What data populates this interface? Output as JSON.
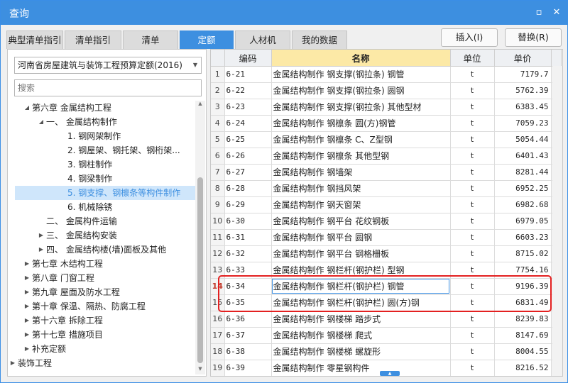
{
  "window": {
    "title": "查询",
    "minimize_glyph": "▫",
    "close_glyph": "✕"
  },
  "tabs": [
    {
      "label": "典型清单指引",
      "active": false
    },
    {
      "label": "清单指引",
      "active": false
    },
    {
      "label": "清单",
      "active": false
    },
    {
      "label": "定额",
      "active": true
    },
    {
      "label": "人材机",
      "active": false
    },
    {
      "label": "我的数据",
      "active": false
    }
  ],
  "actions": {
    "insert_label": "插入(I)",
    "replace_label": "替换(R)"
  },
  "left": {
    "library_select_value": "河南省房屋建筑与装饰工程预算定额(2016)",
    "search_placeholder": "搜索",
    "tree": [
      {
        "label": "第六章 金属结构工程",
        "toggle": "◢",
        "level": 1
      },
      {
        "label": "一、 金属结构制作",
        "toggle": "◢",
        "level": 2
      },
      {
        "label": "1. 钢网架制作",
        "toggle": "",
        "level": 3
      },
      {
        "label": "2. 钢屋架、钢托架、钢桁架...",
        "toggle": "",
        "level": 3
      },
      {
        "label": "3. 钢柱制作",
        "toggle": "",
        "level": 3
      },
      {
        "label": "4. 钢梁制作",
        "toggle": "",
        "level": 3
      },
      {
        "label": "5. 钢支撑、钢檩条等构件制作",
        "toggle": "",
        "level": 3,
        "selected": true
      },
      {
        "label": "6. 机械除锈",
        "toggle": "",
        "level": 3
      },
      {
        "label": "二、 金属构件运输",
        "toggle": "",
        "level": 2
      },
      {
        "label": "三、 金属结构安装",
        "toggle": "▶",
        "level": 2
      },
      {
        "label": "四、 金属结构楼(墙)面板及其他",
        "toggle": "▶",
        "level": 2
      },
      {
        "label": "第七章 木结构工程",
        "toggle": "▶",
        "level": 1
      },
      {
        "label": "第八章 门窗工程",
        "toggle": "▶",
        "level": 1
      },
      {
        "label": "第九章 屋面及防水工程",
        "toggle": "▶",
        "level": 1
      },
      {
        "label": "第十章 保温、隔热、防腐工程",
        "toggle": "▶",
        "level": 1
      },
      {
        "label": "第十六章 拆除工程",
        "toggle": "▶",
        "level": 1
      },
      {
        "label": "第十七章 措施项目",
        "toggle": "▶",
        "level": 1
      },
      {
        "label": "补充定额",
        "toggle": "▶",
        "level": 1
      },
      {
        "label": "装饰工程",
        "toggle": "▶",
        "level": 0
      }
    ]
  },
  "grid": {
    "columns": {
      "code": "编码",
      "name": "名称",
      "unit": "单位",
      "price": "单价"
    },
    "rows": [
      {
        "idx": "1",
        "code": "6-21",
        "name": "金属结构制作 钢支撑(钢拉条) 钢管",
        "unit": "t",
        "price": "7179.7"
      },
      {
        "idx": "2",
        "code": "6-22",
        "name": "金属结构制作 钢支撑(钢拉条) 圆钢",
        "unit": "t",
        "price": "5762.39"
      },
      {
        "idx": "3",
        "code": "6-23",
        "name": "金属结构制作 钢支撑(钢拉条) 其他型材",
        "unit": "t",
        "price": "6383.45"
      },
      {
        "idx": "4",
        "code": "6-24",
        "name": "金属结构制作 钢檩条 圆(方)钢管",
        "unit": "t",
        "price": "7059.23"
      },
      {
        "idx": "5",
        "code": "6-25",
        "name": "金属结构制作 钢檩条 C、Z型钢",
        "unit": "t",
        "price": "5054.44"
      },
      {
        "idx": "6",
        "code": "6-26",
        "name": "金属结构制作 钢檩条 其他型钢",
        "unit": "t",
        "price": "6401.43"
      },
      {
        "idx": "7",
        "code": "6-27",
        "name": "金属结构制作 钢墙架",
        "unit": "t",
        "price": "8281.44"
      },
      {
        "idx": "8",
        "code": "6-28",
        "name": "金属结构制作 钢挡风架",
        "unit": "t",
        "price": "6952.25"
      },
      {
        "idx": "9",
        "code": "6-29",
        "name": "金属结构制作 钢天窗架",
        "unit": "t",
        "price": "6982.68"
      },
      {
        "idx": "10",
        "code": "6-30",
        "name": "金属结构制作 钢平台 花纹钢板",
        "unit": "t",
        "price": "6979.05"
      },
      {
        "idx": "11",
        "code": "6-31",
        "name": "金属结构制作 钢平台 圆钢",
        "unit": "t",
        "price": "6603.23"
      },
      {
        "idx": "12",
        "code": "6-32",
        "name": "金属结构制作 钢平台 钢格栅板",
        "unit": "t",
        "price": "8715.02"
      },
      {
        "idx": "13",
        "code": "6-33",
        "name": "金属结构制作 钢栏杆(钢护栏) 型钢",
        "unit": "t",
        "price": "7754.16"
      },
      {
        "idx": "14",
        "code": "6-34",
        "name": "金属结构制作 钢栏杆(钢护栏) 钢管",
        "unit": "t",
        "price": "9196.39"
      },
      {
        "idx": "15",
        "code": "6-35",
        "name": "金属结构制作 钢栏杆(钢护栏) 圆(方)钢",
        "unit": "t",
        "price": "6831.49"
      },
      {
        "idx": "16",
        "code": "6-36",
        "name": "金属结构制作 钢楼梯 踏步式",
        "unit": "t",
        "price": "8239.83"
      },
      {
        "idx": "17",
        "code": "6-37",
        "name": "金属结构制作 钢楼梯 爬式",
        "unit": "t",
        "price": "8147.69"
      },
      {
        "idx": "18",
        "code": "6-38",
        "name": "金属结构制作 钢楼梯 螺旋形",
        "unit": "t",
        "price": "8004.55"
      },
      {
        "idx": "19",
        "code": "6-39",
        "name": "金属结构制作 零星钢构件",
        "unit": "t",
        "price": "8216.52"
      }
    ],
    "current_row_idx": "14",
    "highlighted_rows": [
      "14",
      "15"
    ]
  },
  "colors": {
    "accent": "#3d8fe0",
    "highlight_border": "#e32020",
    "name_header_bg": "#fce9a6"
  }
}
